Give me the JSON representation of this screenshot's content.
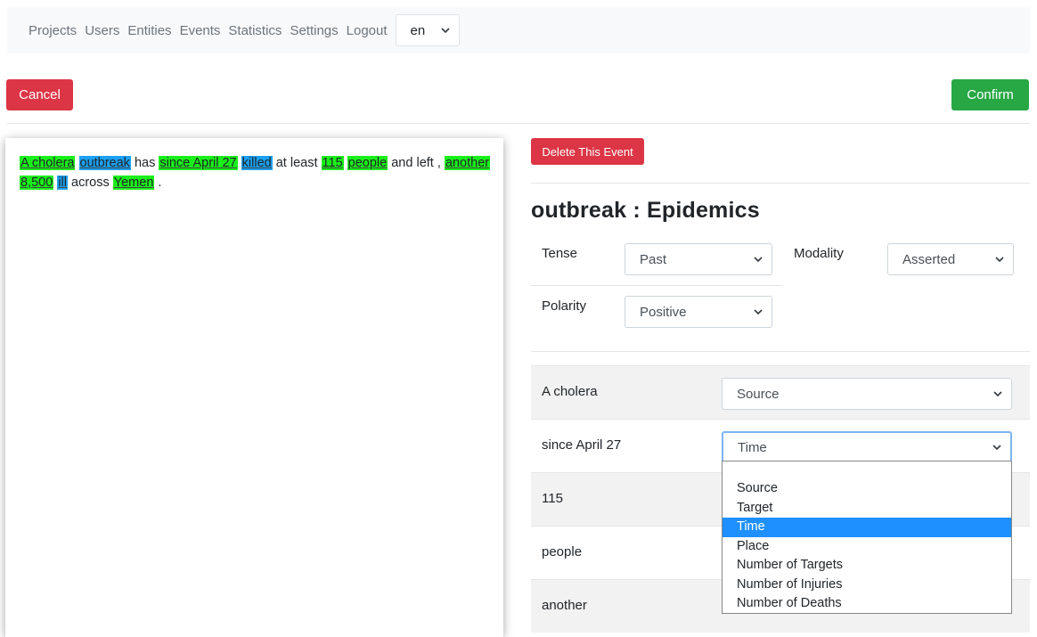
{
  "nav": {
    "links": [
      "Projects",
      "Users",
      "Entities",
      "Events",
      "Statistics",
      "Settings",
      "Logout"
    ],
    "language": "en"
  },
  "actions": {
    "cancel": "Cancel",
    "confirm": "Confirm"
  },
  "text_panel": {
    "tokens": [
      {
        "text": "A cholera",
        "hl": "green"
      },
      {
        "text": " "
      },
      {
        "text": "outbreak",
        "hl": "blue"
      },
      {
        "text": " has "
      },
      {
        "text": "since April 27",
        "hl": "green"
      },
      {
        "text": " "
      },
      {
        "text": "killed",
        "hl": "blue"
      },
      {
        "text": " at least "
      },
      {
        "text": "115",
        "hl": "green"
      },
      {
        "text": " "
      },
      {
        "text": "people",
        "hl": "green"
      },
      {
        "text": " and left , "
      },
      {
        "text": "another",
        "hl": "green"
      },
      {
        "text": " "
      },
      {
        "text": "8,500",
        "hl": "green"
      },
      {
        "text": " "
      },
      {
        "text": "ill",
        "hl": "blue"
      },
      {
        "text": " across "
      },
      {
        "text": "Yemen",
        "hl": "green"
      },
      {
        "text": " ."
      }
    ],
    "highlight_colors": {
      "green": "#19f019",
      "blue": "#1ba1f2"
    }
  },
  "event": {
    "delete_label": "Delete This Event",
    "title": "outbreak : Epidemics",
    "tense": {
      "label": "Tense",
      "value": "Past"
    },
    "modality": {
      "label": "Modality",
      "value": "Asserted"
    },
    "polarity": {
      "label": "Polarity",
      "value": "Positive"
    }
  },
  "roles": [
    {
      "argument": "A cholera",
      "role": "Source"
    },
    {
      "argument": "since April 27",
      "role": "Time"
    },
    {
      "argument": "115",
      "role": ""
    },
    {
      "argument": "people",
      "role": ""
    },
    {
      "argument": "another",
      "role": ""
    }
  ],
  "role_dropdown": {
    "options": [
      "",
      "Source",
      "Target",
      "Time",
      "Place",
      "Number of Targets",
      "Number of Injuries",
      "Number of Deaths"
    ],
    "selected": "Time"
  },
  "colors": {
    "danger": "#dc3545",
    "success": "#28a745",
    "select_highlight": "#1e90ff"
  }
}
